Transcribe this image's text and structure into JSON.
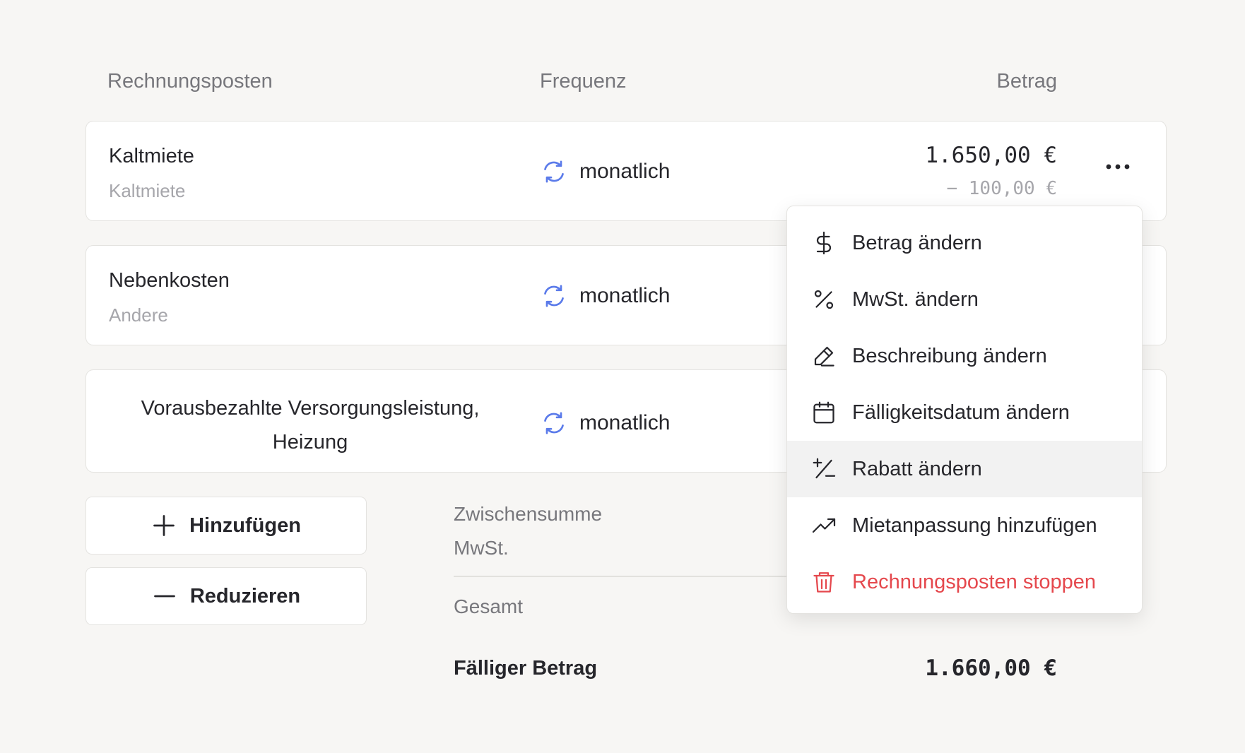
{
  "headers": {
    "item": "Rechnungsposten",
    "frequency": "Frequenz",
    "amount": "Betrag"
  },
  "rows": [
    {
      "title": "Kaltmiete",
      "subtitle": "Kaltmiete",
      "frequency": "monatlich",
      "amount": "1.650,00 €",
      "discount": "− 100,00 €"
    },
    {
      "title": "Nebenkosten",
      "subtitle": "Andere",
      "frequency": "monatlich"
    },
    {
      "title": "Vorausbezahlte Versorgungsleistung, Heizung",
      "frequency": "monatlich"
    }
  ],
  "actions": {
    "add": "Hinzufügen",
    "reduce": "Reduzieren"
  },
  "summary": {
    "subtotal": "Zwischensumme",
    "vat": "MwSt.",
    "total": "Gesamt",
    "due_label": "Fälliger Betrag",
    "due_value": "1.660,00 €"
  },
  "menu": {
    "items": [
      {
        "label": "Betrag ändern",
        "icon": "dollar-icon"
      },
      {
        "label": "MwSt. ändern",
        "icon": "percent-icon"
      },
      {
        "label": "Beschreibung ändern",
        "icon": "pencil-icon"
      },
      {
        "label": "Fälligkeitsdatum ändern",
        "icon": "calendar-icon"
      },
      {
        "label": "Rabatt ändern",
        "icon": "plus-minus-icon",
        "highlighted": true
      },
      {
        "label": "Mietanpassung hinzufügen",
        "icon": "trending-up-icon"
      },
      {
        "label": "Rechnungsposten stoppen",
        "icon": "trash-icon",
        "danger": true
      }
    ]
  },
  "colors": {
    "accent": "#5b7bea",
    "danger": "#e5484d",
    "background": "#f7f6f4"
  }
}
